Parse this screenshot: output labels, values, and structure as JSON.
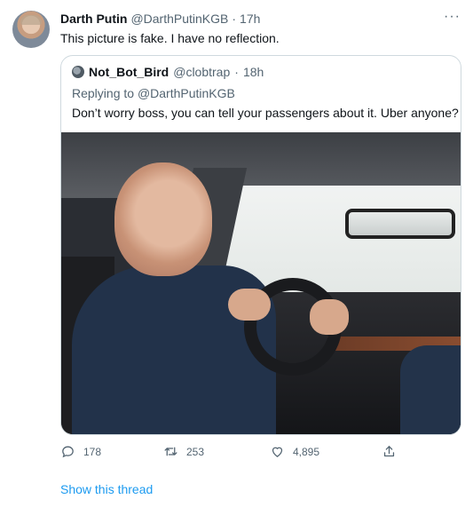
{
  "tweet": {
    "author_name": "Darth Putin",
    "author_handle": "@DarthPutinKGB",
    "dot": "·",
    "time": "17h",
    "more": "···",
    "text": "This picture is fake. I have no reflection."
  },
  "quote": {
    "author_name": "Not_Bot_Bird",
    "author_handle": "@clobtrap",
    "dot": "·",
    "time": "18h",
    "replying_prefix": "Replying to ",
    "replying_handle": "@DarthPutinKGB",
    "text": "Don’t worry boss, you can tell your passengers about it. Uber anyone?"
  },
  "actions": {
    "reply_count": "178",
    "retweet_count": "253",
    "like_count": "4,895",
    "reply_icon": "reply-icon",
    "retweet_icon": "retweet-icon",
    "like_icon": "heart-icon",
    "share_icon": "share-icon"
  },
  "footer": {
    "show_thread": "Show this thread"
  },
  "colors": {
    "link": "#1d9bf0",
    "secondary_text": "#536471",
    "border": "#cfd9de"
  }
}
